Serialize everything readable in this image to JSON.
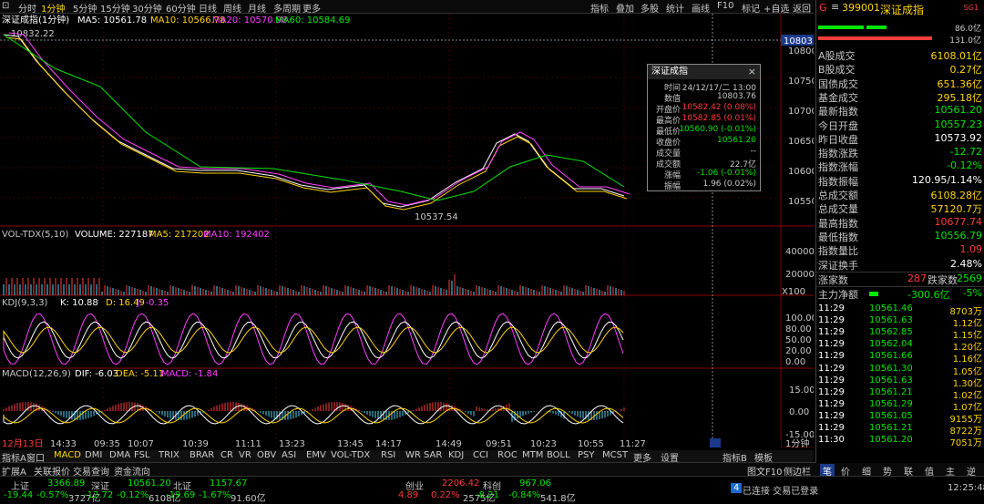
{
  "toolbar": {
    "periods": [
      "分时",
      "1分钟",
      "5分钟",
      "15分钟",
      "30分钟",
      "60分钟",
      "日线",
      "周线",
      "月线",
      "多周期",
      "更多"
    ],
    "right": [
      "指标",
      "叠加",
      "多股",
      "统计",
      "画线",
      "F10",
      "标记",
      "+自选",
      "返回"
    ]
  },
  "main_legend": {
    "title": "深证成指(1分钟)",
    "ma5": "MA5: 10561.78",
    "ma10": "MA10: 10566.78",
    "ma20": "MA20: 10570.98",
    "ma60": "MA60: 10584.69",
    "high_mark": "10832.22",
    "low_mark": "10537.54",
    "cursor_price": "10803.8",
    "y_ticks": [
      "10800",
      "10750",
      "10700",
      "10650",
      "10600",
      "10550"
    ]
  },
  "vol_legend": {
    "title": "VOL-TDX(5,10)",
    "volume": "VOLUME: 227187",
    "ma5": "MA5: 217202",
    "ma10": "MA10: 192402",
    "y_ticks": [
      "40000",
      "20000",
      "X100"
    ]
  },
  "kdj_legend": {
    "title": "KDJ(9,3,3)",
    "k": "K: 10.88",
    "d": "D: 16.49",
    "j": "J: -0.35",
    "y_ticks": [
      "100.00",
      "80.00",
      "50.00",
      "20.00",
      "0.00"
    ]
  },
  "macd_legend": {
    "title": "MACD(12,26,9)",
    "dif": "DIF: -6.03",
    "dea": "DEA: -5.11",
    "macd": "MACD: -1.84",
    "y_ticks": [
      "15.00",
      "0.00",
      "-15.00"
    ]
  },
  "x_axis": {
    "labels": [
      "12月13日",
      "14:33",
      "09:35",
      "10:07",
      "10:39",
      "11:11",
      "13:23",
      "13:45",
      "14:17",
      "14:49",
      "09:51",
      "10:23",
      "10:55",
      "11:27"
    ],
    "period": "1分钟"
  },
  "popup": {
    "title": "深证成指",
    "rows": [
      {
        "k": "时间",
        "v": "24/12/17/二 13:00",
        "c": "#c8c8c8"
      },
      {
        "k": "数值",
        "v": "10803.76",
        "c": "#c8c8c8"
      },
      {
        "k": "开盘价",
        "v": "10582.42 (0.08%)",
        "c": "#ff3c3c"
      },
      {
        "k": "最高价",
        "v": "10582.85 (0.01%)",
        "c": "#ff3c3c"
      },
      {
        "k": "最低价",
        "v": "10560.90 (-0.01%)",
        "c": "#00e600"
      },
      {
        "k": "收盘价",
        "v": "10561.20",
        "c": "#00e600"
      },
      {
        "k": "成交量",
        "v": "--",
        "c": "#c8c8c8"
      },
      {
        "k": "成交额",
        "v": "22.7亿",
        "c": "#c8c8c8"
      },
      {
        "k": "涨幅",
        "v": "-1.06 (-0.01%)",
        "c": "#00e600"
      },
      {
        "k": "振幅",
        "v": "1.96 (0.02%)",
        "c": "#c8c8c8"
      }
    ]
  },
  "bottom_tabs": [
    "指标A",
    "窗口",
    "MACD",
    "DMI",
    "DMA",
    "FSL",
    "TRIX",
    "BRAR",
    "CR",
    "VR",
    "OBV",
    "ASI",
    "EMV",
    "VOL-TDX",
    "RSI",
    "WR",
    "SAR",
    "KDJ",
    "CCI",
    "ROC",
    "MTM",
    "BOLL",
    "PSY",
    "MCST",
    "更多",
    "设置"
  ],
  "bottom_right_tabs": [
    "指标B",
    "模板"
  ],
  "func_tabs": [
    "扩展A",
    "关联报价",
    "交易查询",
    "资金流向"
  ],
  "func_right": [
    "图文F10",
    "侧边栏"
  ],
  "panel": {
    "code": "399001",
    "name": "深证成指",
    "tag": "SG1",
    "bar1": "86.0亿",
    "bar2": "131.0亿",
    "stats": [
      {
        "k": "A股成交",
        "v": "6108.01亿",
        "c": "yellow"
      },
      {
        "k": "B股成交",
        "v": "0.27亿",
        "c": "yellow"
      },
      {
        "k": "国债成交",
        "v": "651.36亿",
        "c": "yellow"
      },
      {
        "k": "基金成交",
        "v": "295.18亿",
        "c": "yellow"
      },
      {
        "k": "最新指数",
        "v": "10561.20",
        "c": "green"
      },
      {
        "k": "今日开盘",
        "v": "10557.23",
        "c": "green"
      },
      {
        "k": "昨日收盘",
        "v": "10573.92",
        "c": "white"
      },
      {
        "k": "指数涨跌",
        "v": "-12.72",
        "c": "green"
      },
      {
        "k": "指数涨幅",
        "v": "-0.12%",
        "c": "green"
      },
      {
        "k": "指数振幅",
        "v": "120.95/1.14%",
        "c": "white"
      },
      {
        "k": "总成交额",
        "v": "6108.28亿",
        "c": "yellow"
      },
      {
        "k": "总成交量",
        "v": "57120.7万",
        "c": "yellow"
      },
      {
        "k": "最高指数",
        "v": "10677.74",
        "c": "red"
      },
      {
        "k": "最低指数",
        "v": "10556.79",
        "c": "green"
      },
      {
        "k": "指数量比",
        "v": "1.09",
        "c": "red"
      },
      {
        "k": "深证换手",
        "v": "2.48%",
        "c": "white"
      }
    ],
    "up_label": "涨家数",
    "up": "287",
    "down_label": "跌家数",
    "down": "2569",
    "net_label": "主力净额",
    "net": "-300.6亿",
    "net_pct": "-5%",
    "ticks": [
      {
        "t": "11:29",
        "p": "10561.46",
        "a": "8703万"
      },
      {
        "t": "11:29",
        "p": "10561.63",
        "a": "1.12亿"
      },
      {
        "t": "11:29",
        "p": "10562.85",
        "a": "1.15亿"
      },
      {
        "t": "11:29",
        "p": "10562.04",
        "a": "1.20亿"
      },
      {
        "t": "11:29",
        "p": "10561.66",
        "a": "1.16亿"
      },
      {
        "t": "11:29",
        "p": "10561.30",
        "a": "1.05亿"
      },
      {
        "t": "11:29",
        "p": "10561.63",
        "a": "1.30亿"
      },
      {
        "t": "11:29",
        "p": "10561.21",
        "a": "1.02亿"
      },
      {
        "t": "11:29",
        "p": "10561.29",
        "a": "1.07亿"
      },
      {
        "t": "11:29",
        "p": "10561.05",
        "a": "9155万"
      },
      {
        "t": "11:29",
        "p": "10561.21",
        "a": "8722万"
      },
      {
        "t": "11:30",
        "p": "10561.20",
        "a": "7051万"
      }
    ],
    "tabs": [
      "笔",
      "价",
      "细",
      "势",
      "联",
      "值",
      "主",
      "逆"
    ]
  },
  "status": {
    "items": [
      {
        "name": "上证",
        "val": "3366.89",
        "chg": "-19.44",
        "pct": "-0.57%",
        "amt": "3727亿"
      },
      {
        "name": "深证",
        "val": "10561.20",
        "chg": "-12.72",
        "pct": "-0.12%",
        "amt": "6108亿"
      },
      {
        "name": "北证",
        "val": "1157.67",
        "chg": "-19.69",
        "pct": "-1.67%",
        "amt": "91.60亿"
      },
      {
        "name": "创业",
        "val": "2206.42",
        "chg": "4.89",
        "pct": "0.22%",
        "amt": "2575亿"
      },
      {
        "name": "科创",
        "val": "967.06",
        "chg": "-8.21",
        "pct": "-0.84%",
        "amt": "541.8亿"
      }
    ],
    "conn": "已连接 交易已登录",
    "badge": "4",
    "time": "12:25:48"
  }
}
